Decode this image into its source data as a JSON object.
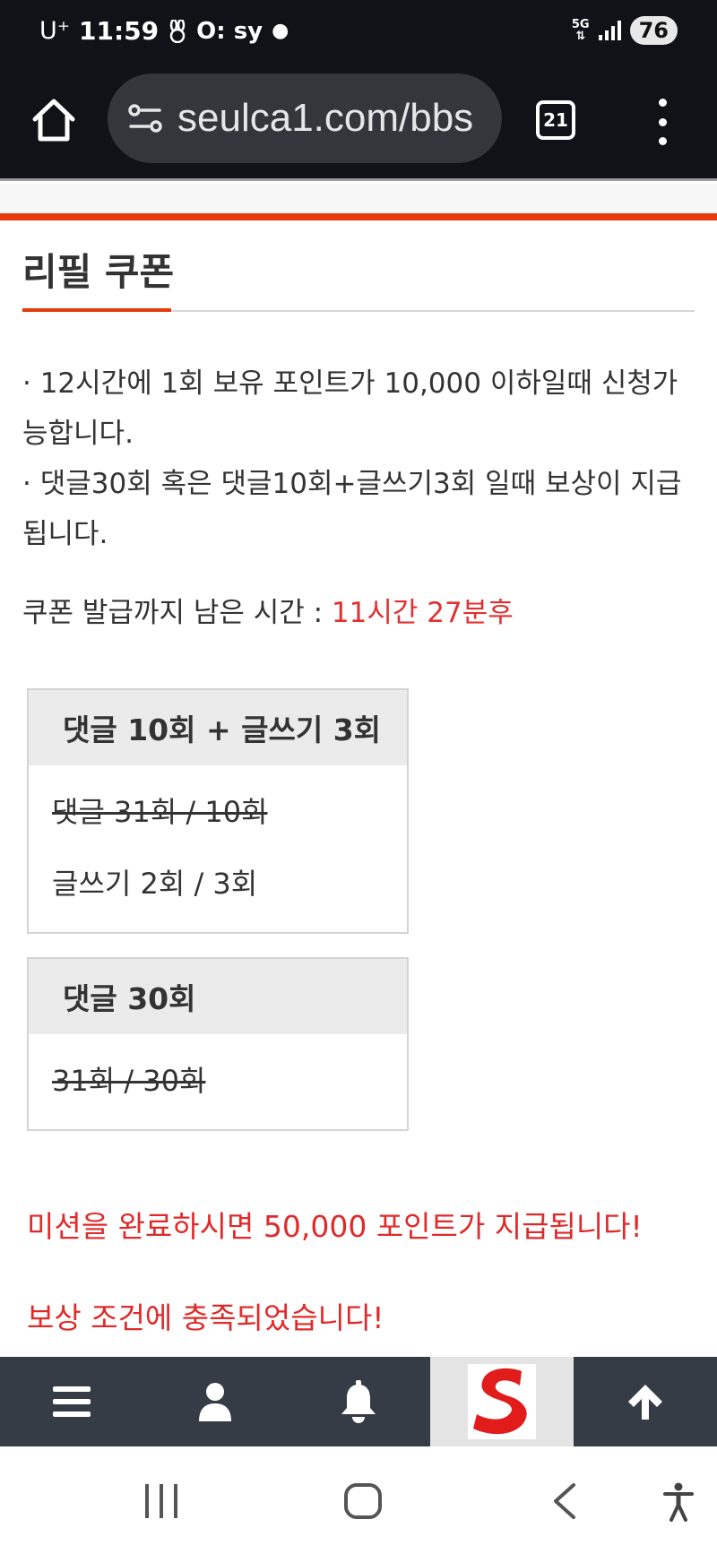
{
  "status_bar": {
    "carrier": "U⁺",
    "time": "11:59",
    "app_label": "O: sy",
    "network": "5G",
    "battery": "76"
  },
  "browser": {
    "url": "seulca1.com/bbs",
    "tab_count": "21"
  },
  "page": {
    "title": "리필 쿠폰",
    "rules": [
      "· 12시간에 1회 보유 포인트가 10,000 이하일때 신청가능합니다.",
      "· 댓글30회 혹은 댓글10회+글쓰기3회 일때 보상이 지급됩니다."
    ],
    "timer_label": "쿠폰 발급까지 남은 시간 : ",
    "timer_value": "11시간 27분후",
    "missions": [
      {
        "title": "댓글 10회 + 글쓰기 3회",
        "rows": [
          {
            "text": "댓글 31회 / 10회",
            "completed": true
          },
          {
            "text": "글쓰기 2회 / 3회",
            "completed": false
          }
        ]
      },
      {
        "title": "댓글 30회",
        "rows": [
          {
            "text": "31회 / 30회",
            "completed": true
          }
        ]
      }
    ],
    "reward_notice": "미션을 완료하시면 50,000 포인트가 지급됩니다!",
    "status_notice": "보상 조건에 충족되었습니다!"
  },
  "bottom_nav": {
    "items": [
      "menu-icon",
      "user-icon",
      "bell-icon",
      "site-logo",
      "arrow-up-icon"
    ]
  },
  "colors": {
    "accent": "#e8380d",
    "alert_red": "#e02a2a",
    "nav_bg": "#353c46",
    "browser_bg": "#111217"
  }
}
